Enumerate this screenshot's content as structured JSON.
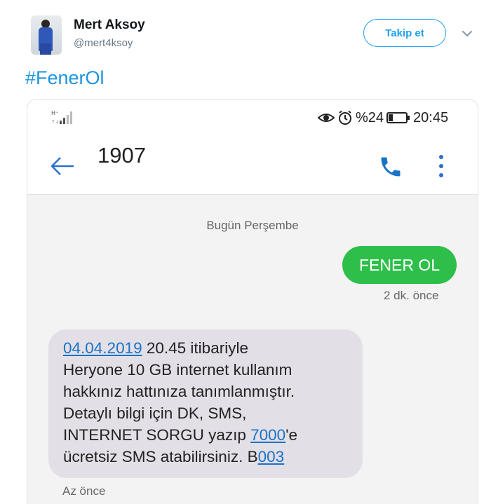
{
  "tweet": {
    "user_name": "Mert Aksoy",
    "user_handle": "@mert4ksoy",
    "follow_label": "Takip et",
    "hashtag": "#FenerOl"
  },
  "phone": {
    "status_bar": {
      "battery": "%24",
      "time": "20:45"
    },
    "contact_name": "1907",
    "day_label": "Bugün Perşembe",
    "sent_message": {
      "text": "FENER OL",
      "time": "2 dk. önce"
    },
    "received_message": {
      "date_link": "04.04.2019",
      "line1_rest": " 20.45 itibariyle",
      "line2": "Heryone 10 GB internet kullanım",
      "line3": "hakkınız hattınıza tanımlanmıştır.",
      "line4": "Detaylı bilgi için DK, SMS,",
      "line5_start": "INTERNET SORGU yazıp ",
      "number_link": "7000",
      "line5_end": "'e",
      "line6_start": "ücretsiz SMS atabilirsiniz. B",
      "code_link": "003",
      "time": "Az önce"
    }
  },
  "colors": {
    "twitter_blue": "#1da1f2",
    "hashtag_blue": "#1b95e0",
    "sent_bubble": "#2dbf4a",
    "received_bubble": "#e2dfe6",
    "phone_accent": "#1a73c7"
  },
  "icons": [
    "avatar",
    "chevron-down-icon",
    "signal-icon",
    "eye-icon",
    "alarm-icon",
    "battery-icon",
    "back-arrow-icon",
    "phone-call-icon",
    "more-vert-icon"
  ]
}
